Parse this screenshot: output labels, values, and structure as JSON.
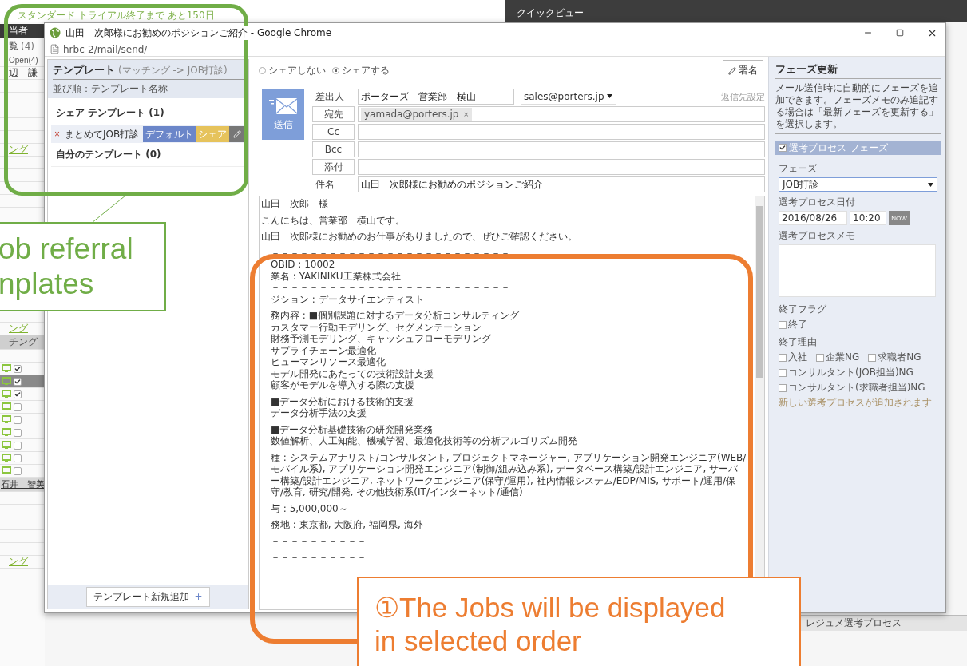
{
  "background_app": {
    "banner": "スタンダード トライアル終了まで あと150日",
    "quick_view": "クイックビュー",
    "strip": [
      {
        "kind": "header",
        "text": "当者"
      },
      {
        "kind": "count",
        "text": "覧",
        "count": "(4)"
      },
      {
        "kind": "tab",
        "text": "Open(4)"
      },
      {
        "kind": "name",
        "text": "辺　謙"
      },
      {
        "kind": "blank"
      },
      {
        "kind": "blank"
      },
      {
        "kind": "blank"
      },
      {
        "kind": "blank"
      },
      {
        "kind": "blank"
      },
      {
        "kind": "link",
        "text": "ング"
      },
      {
        "kind": "blank"
      },
      {
        "kind": "blank"
      },
      {
        "kind": "blank"
      },
      {
        "kind": "blank"
      },
      {
        "kind": "blank"
      },
      {
        "kind": "blank"
      },
      {
        "kind": "blank"
      },
      {
        "kind": "blank"
      },
      {
        "kind": "blank"
      },
      {
        "kind": "blank"
      },
      {
        "kind": "blank"
      },
      {
        "kind": "blank"
      },
      {
        "kind": "blank"
      },
      {
        "kind": "link",
        "text": "ング"
      },
      {
        "kind": "bar",
        "text": "チング"
      },
      {
        "kind": "blank"
      },
      {
        "kind": "check",
        "checked": true,
        "selected": false
      },
      {
        "kind": "check",
        "checked": true,
        "selected": true
      },
      {
        "kind": "check",
        "checked": true,
        "selected": false
      },
      {
        "kind": "check",
        "checked": false,
        "selected": false
      },
      {
        "kind": "check",
        "checked": false,
        "selected": false
      },
      {
        "kind": "check",
        "checked": false,
        "selected": false
      },
      {
        "kind": "check",
        "checked": false,
        "selected": false
      },
      {
        "kind": "check",
        "checked": false,
        "selected": false
      },
      {
        "kind": "check",
        "checked": false,
        "selected": false
      },
      {
        "kind": "person",
        "text": "石井　智美"
      },
      {
        "kind": "blank"
      },
      {
        "kind": "blank"
      },
      {
        "kind": "blank"
      },
      {
        "kind": "blank"
      },
      {
        "kind": "blank"
      },
      {
        "kind": "link",
        "text": "ング"
      }
    ],
    "footer_tab": "レジュメ選考プロセス"
  },
  "window": {
    "title": "山田　次郎様にお勧めのポジションご紹介 - Google Chrome",
    "url": "hrbc-2/mail/send/"
  },
  "templates": {
    "title": "テンプレート",
    "subtitle": "(マッチング -> JOB打診)",
    "sort": "並び順：テンプレート名称",
    "sections": [
      {
        "title": "シェア テンプレート (1)",
        "templates": [
          {
            "delete": "×",
            "name": "まとめてJOB打診",
            "selected": true,
            "tags": [
              {
                "label": "デフォルト",
                "color": "#6b86c9"
              },
              {
                "label": "シェア",
                "color": "#e6c35c"
              }
            ]
          }
        ]
      },
      {
        "title": "自分のテンプレート (0)"
      }
    ],
    "add_button": "テンプレート新規追加",
    "add_icon": "+"
  },
  "compose": {
    "share_options": [
      {
        "label": "シェアしない",
        "selected": false
      },
      {
        "label": "シェアする",
        "selected": true
      }
    ],
    "signature_button": "署名",
    "send_button": "送信",
    "fields": [
      {
        "kind": "sender",
        "label": "差出人",
        "value": "ポーターズ　営業部　横山",
        "address": "sales@porters.jp",
        "link": "返信先設定"
      },
      {
        "kind": "address",
        "label": "宛先",
        "chips": [
          {
            "address": "yamada@porters.jp",
            "remove": "×"
          }
        ]
      },
      {
        "kind": "address",
        "label": "Cc"
      },
      {
        "kind": "address",
        "label": "Bcc"
      },
      {
        "kind": "address",
        "label": "添付"
      },
      {
        "kind": "subject",
        "label": "件名",
        "value": "山田　次郎様にお勧めのポジションご紹介"
      }
    ],
    "body": [
      [
        "山田　次郎　様"
      ],
      [
        "こんにちは、営業部　横山です。"
      ],
      [
        "山田　次郎様にお勧めのお仕事がありましたので、ぜひご確認ください。"
      ],
      [
        "－－－－－－－－－－－－－－－－－－－－－－－－－",
        "OBID : 10002",
        "業名 : YAKINIKU工業株式会社",
        "－－－－－－－－－－－－－－－－－－－－－－－－－",
        "ジション : データサイエンティスト"
      ],
      [
        "務内容 : ■個別課題に対するデータ分析コンサルティング",
        "カスタマー行動モデリング、セグメンテーション",
        "財務予測モデリング、キャッシュフローモデリング",
        "サプライチェーン最適化",
        "ヒューマンリソース最適化",
        "モデル開発にあたっての技術設計支援",
        "顧客がモデルを導入する際の支援"
      ],
      [
        "■データ分析における技術的支援",
        "データ分析手法の支援"
      ],
      [
        "■データ分析基礎技術の研究開発業務",
        "数値解析、人工知能、機械学習、最適化技術等の分析アルゴリズム開発"
      ],
      [
        "種 : システムアナリスト/コンサルタント, プロジェクトマネージャー, アプリケーション開発エンジニア(WEB/モバイル系), アプリケーション開発エンジニア(制御/組み込み系), データベース構築/設計エンジニア, サーバー構築/設計エンジニア, ネットワークエンジニア(保守/運用), 社内情報システム/EDP/MIS, サポート/運用/保守/教育, 研究/開発, その他技術系(IT/インターネット/通信)"
      ],
      [
        "与 : 5,000,000～"
      ],
      [
        "務地 : 東京都, 大阪府, 福岡県, 海外"
      ],
      [
        "－－－－－－－－－－"
      ],
      [
        "－－－－－－－－－－"
      ]
    ]
  },
  "phase_panel": {
    "title": "フェーズ更新",
    "description": "メール送信時に自動的にフェーズを追加できます。フェーズメモのみ追記する場合は「最新フェーズを更新する」を選択します。",
    "section": {
      "label": "選考プロセス フェーズ",
      "checked": true
    },
    "phase_label": "フェーズ",
    "phase_value": "JOB打診",
    "date_label": "選考プロセス日付",
    "date": "2016/08/26",
    "time": "10:20",
    "now_button": "NOW",
    "memo_label": "選考プロセスメモ",
    "end_flag_label": "終了フラグ",
    "end_flag": {
      "label": "終了",
      "checked": false
    },
    "end_reason_label": "終了理由",
    "end_reasons": [
      [
        {
          "label": "入社",
          "checked": false
        },
        {
          "label": "企業NG",
          "checked": false
        },
        {
          "label": "求職者NG",
          "checked": false
        }
      ],
      [
        {
          "label": "コンサルタント(JOB担当)NG",
          "checked": false
        }
      ],
      [
        {
          "label": "コンサルタント(求職者担当)NG",
          "checked": false
        }
      ]
    ],
    "note": "新しい選考プロセスが追加されます"
  },
  "annotations": [
    {
      "kind": "highlight",
      "color": "#70ad47"
    },
    {
      "kind": "callout",
      "color": "#70ad47",
      "lines": [
        "ob referral",
        "nplates"
      ]
    },
    {
      "kind": "highlight",
      "color": "#ed7d31"
    },
    {
      "kind": "callout",
      "color": "#ed7d31",
      "lines": [
        "①The Jobs will be displayed",
        "in selected order"
      ]
    }
  ]
}
